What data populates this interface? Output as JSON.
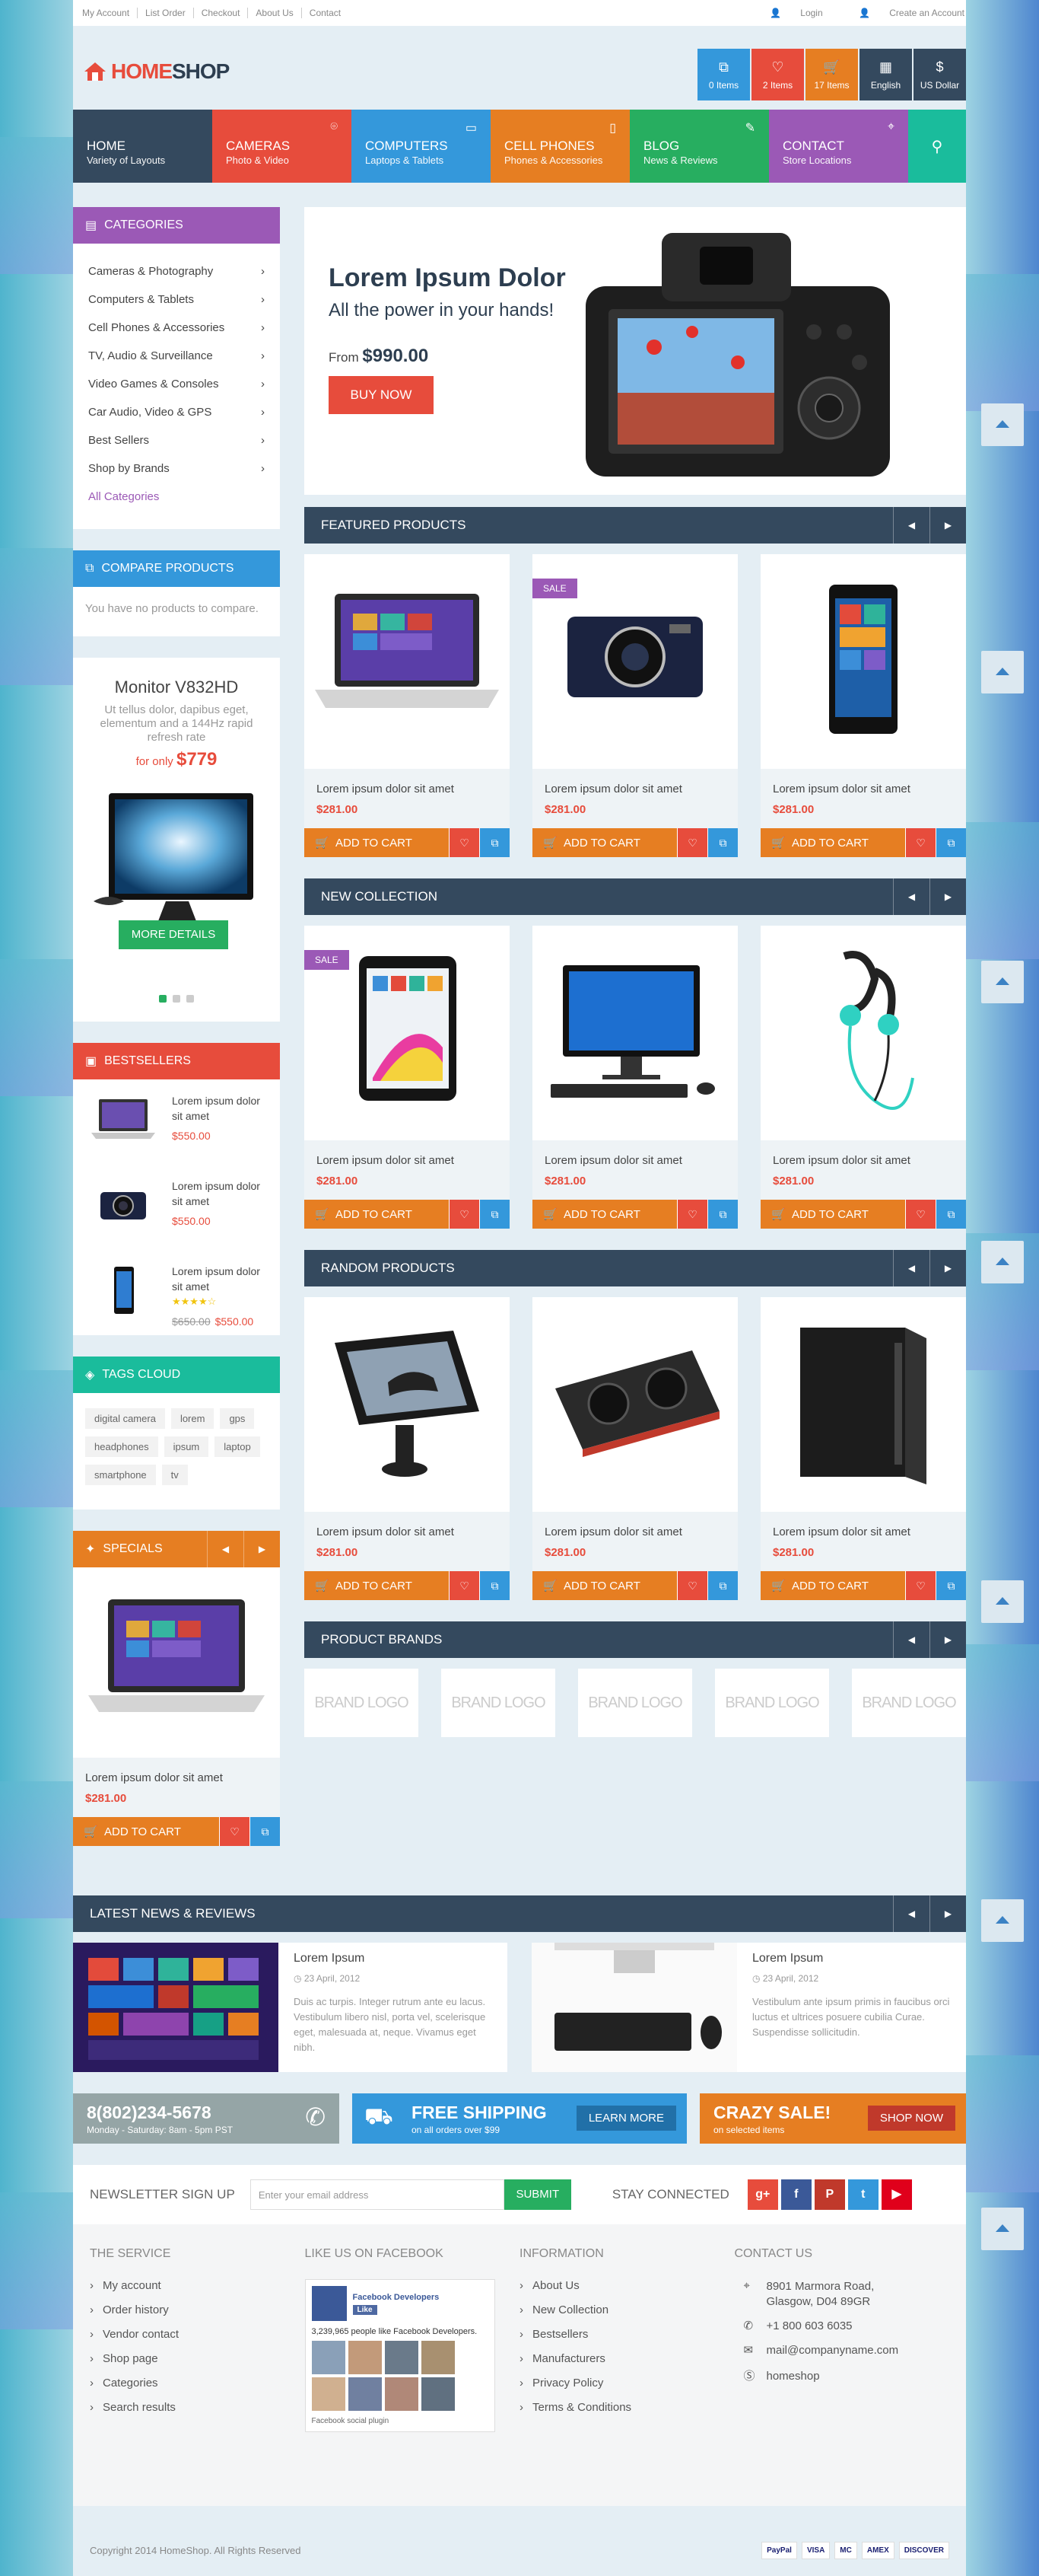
{
  "colors": {
    "purple": "#9b59b6",
    "blue": "#3498db",
    "red": "#e74c3c",
    "orange": "#e67e22",
    "green": "#27ae60",
    "teal": "#1abc9c",
    "navy": "#34495e"
  },
  "topbar": {
    "links": [
      "My Account",
      "List Order",
      "Checkout",
      "About Us",
      "Contact"
    ],
    "login": "Login",
    "create": "Create an Account"
  },
  "logo": {
    "part1": "HOME",
    "part2": "SHOP"
  },
  "header_buttons": [
    {
      "icon": "compare-icon",
      "label": "0 Items"
    },
    {
      "icon": "heart-icon",
      "label": "2 Items"
    },
    {
      "icon": "cart-icon",
      "label": "17 Items"
    },
    {
      "icon": "flag-icon",
      "label": "English"
    },
    {
      "icon": "dollar-icon",
      "label": "US Dollar",
      "glyph": "$"
    }
  ],
  "nav": [
    {
      "title": "HOME",
      "sub": "Variety of Layouts"
    },
    {
      "title": "CAMERAS",
      "sub": "Photo & Video"
    },
    {
      "title": "COMPUTERS",
      "sub": "Laptops & Tablets"
    },
    {
      "title": "CELL PHONES",
      "sub": "Phones & Accessories"
    },
    {
      "title": "BLOG",
      "sub": "News & Reviews"
    },
    {
      "title": "CONTACT",
      "sub": "Store Locations"
    }
  ],
  "categories": {
    "title": "CATEGORIES",
    "items": [
      "Cameras & Photography",
      "Computers & Tablets",
      "Cell Phones & Accessories",
      "TV, Audio & Surveillance",
      "Video Games & Consoles",
      "Car Audio, Video & GPS",
      "Best Sellers",
      "Shop by Brands"
    ],
    "all": "All Categories"
  },
  "compare": {
    "title": "COMPARE PRODUCTS",
    "text": "You have no products to compare."
  },
  "promo": {
    "title": "Monitor V832HD",
    "text": "Ut tellus dolor, dapibus eget, elementum and a 144Hz rapid refresh rate",
    "price_prefix": "for only",
    "price": "$779",
    "button": "MORE DETAILS"
  },
  "bestsellers": {
    "title": "BESTSELLERS",
    "items": [
      {
        "name": "Lorem ipsum dolor sit amet",
        "price": "$550.00",
        "old": "",
        "rating": ""
      },
      {
        "name": "Lorem ipsum dolor sit amet",
        "price": "$550.00",
        "old": "",
        "rating": ""
      },
      {
        "name": "Lorem ipsum dolor sit amet",
        "price": "$550.00",
        "old": "$650.00",
        "rating": "★★★★☆"
      }
    ]
  },
  "tags": {
    "title": "TAGS CLOUD",
    "items": [
      "digital camera",
      "lorem",
      "gps",
      "headphones",
      "ipsum",
      "laptop",
      "smartphone",
      "tv"
    ]
  },
  "specials": {
    "title": "SPECIALS",
    "name": "Lorem ipsum dolor sit amet",
    "price": "$281.00",
    "cart": "ADD TO CART"
  },
  "slider": {
    "title": "Lorem Ipsum Dolor",
    "subtitle": "All the power in your hands!",
    "from": "From",
    "price": "$990.00",
    "button": "BUY NOW"
  },
  "sections": {
    "featured": "FEATURED PRODUCTS",
    "newc": "NEW COLLECTION",
    "random": "RANDOM PRODUCTS",
    "brands": "PRODUCT BRANDS",
    "news": "LATEST NEWS & REVIEWS"
  },
  "product_common": {
    "name": "Lorem ipsum dolor sit amet",
    "price": "$281.00",
    "cart": "ADD TO CART",
    "sale": "SALE"
  },
  "brands": [
    "BRAND LOGO",
    "BRAND LOGO",
    "BRAND LOGO",
    "BRAND LOGO",
    "BRAND LOGO"
  ],
  "news": [
    {
      "title": "Lorem Ipsum",
      "date": "23 April, 2012",
      "text": "Duis ac turpis. Integer rutrum ante eu lacus. Vestibulum libero nisl, porta vel, scelerisque eget, malesuada at, neque. Vivamus eget nibh."
    },
    {
      "title": "Lorem Ipsum",
      "date": "23 April, 2012",
      "text": "Vestibulum ante ipsum primis in faucibus orci luctus et ultrices posuere cubilia Curae. Suspendisse sollicitudin."
    }
  ],
  "banners": {
    "phone": {
      "big": "8(802)234-5678",
      "small": "Monday - Saturday: 8am - 5pm PST"
    },
    "ship": {
      "big": "FREE SHIPPING",
      "small": "on all orders over $99",
      "btn": "LEARN MORE"
    },
    "sale": {
      "big": "CRAZY SALE!",
      "small": "on selected items",
      "btn": "SHOP NOW"
    }
  },
  "newsletter": {
    "label": "NEWSLETTER SIGN UP",
    "placeholder": "Enter your email address",
    "submit": "SUBMIT",
    "stay": "STAY CONNECTED"
  },
  "social": [
    "g+",
    "f",
    "P",
    "t",
    "▶"
  ],
  "footer": {
    "service": {
      "title": "THE SERVICE",
      "items": [
        "My account",
        "Order history",
        "Vendor contact",
        "Shop page",
        "Categories",
        "Search results"
      ]
    },
    "facebook": {
      "title": "LIKE US ON FACEBOOK",
      "name": "Facebook Developers",
      "like": "Like",
      "count": "3,239,965 people like Facebook Developers.",
      "plugin": "Facebook social plugin"
    },
    "info": {
      "title": "INFORMATION",
      "items": [
        "About Us",
        "New Collection",
        "Bestsellers",
        "Manufacturers",
        "Privacy Policy",
        "Terms & Conditions"
      ]
    },
    "contact": {
      "title": "CONTACT US",
      "address": "8901 Marmora Road, Glasgow, D04 89GR",
      "phone": "+1 800 603 6035",
      "email": "mail@companyname.com",
      "skype": "homeshop"
    }
  },
  "copyright": "Copyright 2014 HomeShop. All Rights Reserved",
  "payments": [
    "PayPal",
    "VISA",
    "MC",
    "AMEX",
    "DISCOVER"
  ]
}
